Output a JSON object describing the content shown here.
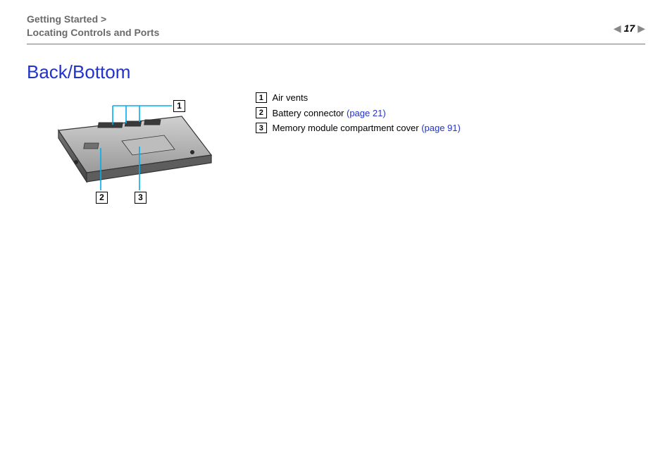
{
  "header": {
    "breadcrumb_line1": "Getting Started >",
    "breadcrumb_line2": "Locating Controls and Ports",
    "page_number": "17"
  },
  "title": "Back/Bottom",
  "callouts": {
    "c1": "1",
    "c2": "2",
    "c3": "3"
  },
  "legend": {
    "items": [
      {
        "num": "1",
        "text": "Air vents",
        "link": ""
      },
      {
        "num": "2",
        "text": "Battery connector ",
        "link": "(page 21)"
      },
      {
        "num": "3",
        "text": "Memory module compartment cover ",
        "link": "(page 91)"
      }
    ]
  }
}
